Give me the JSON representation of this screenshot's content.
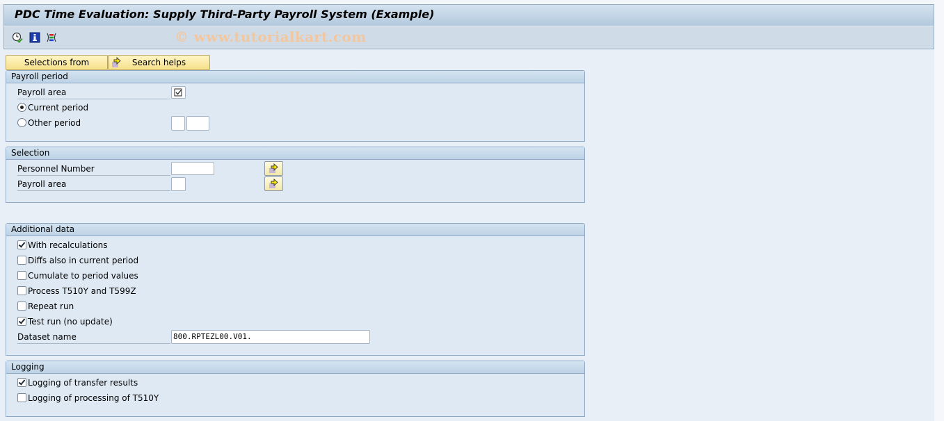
{
  "window": {
    "title": "PDC Time Evaluation: Supply Third-Party Payroll System (Example)",
    "watermark": "© www.tutorialkart.com"
  },
  "toolbar": {
    "icons": [
      {
        "name": "execute-clock-icon"
      },
      {
        "name": "program-info-icon"
      },
      {
        "name": "selection-screen-icon"
      }
    ]
  },
  "buttons": {
    "selections_from": "Selections from",
    "search_helps": "Search helps"
  },
  "groups": {
    "payroll_period": {
      "title": "Payroll period",
      "payroll_area_label": "Payroll area",
      "payroll_area_value": "",
      "current_period_label": "Current period",
      "current_period_selected": true,
      "other_period_label": "Other period",
      "other_period_selected": false,
      "other_period_period": "",
      "other_period_year": ""
    },
    "selection": {
      "title": "Selection",
      "personnel_number_label": "Personnel Number",
      "personnel_number_value": "",
      "payroll_area_label": "Payroll area",
      "payroll_area_value": ""
    },
    "additional_data": {
      "title": "Additional data",
      "checkboxes": [
        {
          "label": "With recalculations",
          "checked": true
        },
        {
          "label": "Diffs also in current period",
          "checked": false
        },
        {
          "label": "Cumulate to period values",
          "checked": false
        },
        {
          "label": "Process T510Y and T599Z",
          "checked": false
        },
        {
          "label": "Repeat run",
          "checked": false
        },
        {
          "label": "Test run (no update)",
          "checked": true
        }
      ],
      "dataset_label": "Dataset name",
      "dataset_value": "800.RPTEZL00.V01."
    },
    "logging": {
      "title": "Logging",
      "checkboxes": [
        {
          "label": "Logging of transfer results",
          "checked": true
        },
        {
          "label": "Logging of processing of T510Y",
          "checked": false
        }
      ]
    }
  }
}
